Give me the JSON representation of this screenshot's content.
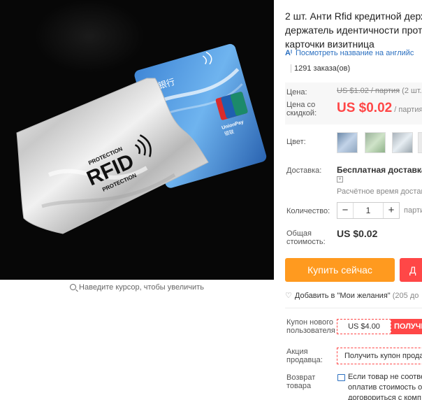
{
  "product": {
    "title_lines": [
      "2 шт. Анти Rfid кредитной держа",
      "держатель идентичности проте",
      "карточки визитница"
    ],
    "translate_link": "Посмотреть название на английс",
    "orders": "1291 заказа(ов)",
    "zoom_hint": "Наведите курсор, чтобы увеличить"
  },
  "image": {
    "sleeve_text_main": "RFID",
    "sleeve_text_top": "PROTECTION",
    "sleeve_text_bottom": "PROTECTION",
    "card_brand_top": "UnionPay",
    "card_brand_bottom": "银联",
    "card_bank_fragment": "银行"
  },
  "price": {
    "label": "Цена:",
    "old_value": "US $1.02 / партия",
    "old_suffix": " (2 шт.",
    "discount_label_1": "Цена со",
    "discount_label_2": "скидкой:",
    "new_value": "US $0.02",
    "per": "/ партия"
  },
  "color": {
    "label": "Цвет:",
    "swatch_icons": [
      "color-blue-thumbnail",
      "color-green-thumbnail",
      "color-silver-thumbnail",
      "color-fourth-thumbnail"
    ]
  },
  "shipping": {
    "label": "Доставка:",
    "value": "Бесплатная доставка в",
    "chevron": "˅",
    "estimate": "Расчётное время доставки"
  },
  "quantity": {
    "label": "Количество:",
    "minus": "−",
    "value": "1",
    "plus": "+",
    "note": "партия"
  },
  "total": {
    "label_1": "Общая",
    "label_2": "стоимость:",
    "value": "US $0.02"
  },
  "actions": {
    "buy_now": "Купить сейчас",
    "add_cart": "Д"
  },
  "wishlist": {
    "icon": "♡",
    "label": "Добавить в \"Мои желания\"",
    "count": " (205 до"
  },
  "coupons": {
    "new_user_label_1": "Купон нового",
    "new_user_label_2": "пользователя",
    "new_user_value": "US $4.00",
    "new_user_button": "ПОЛУЧИ",
    "seller_label_1": "Акция",
    "seller_label_2": "продавца:",
    "seller_button": "Получить купон продав"
  },
  "returns": {
    "label_1": "Возврат",
    "label_2": "товара",
    "text_1": "Если товар не соотве",
    "text_2": "оплатив стоимость о",
    "text_3": "договориться с комп"
  },
  "colors": {
    "accent_red": "#ff4747",
    "accent_orange": "#ff9a1f",
    "link_blue": "#2a6fc0"
  }
}
